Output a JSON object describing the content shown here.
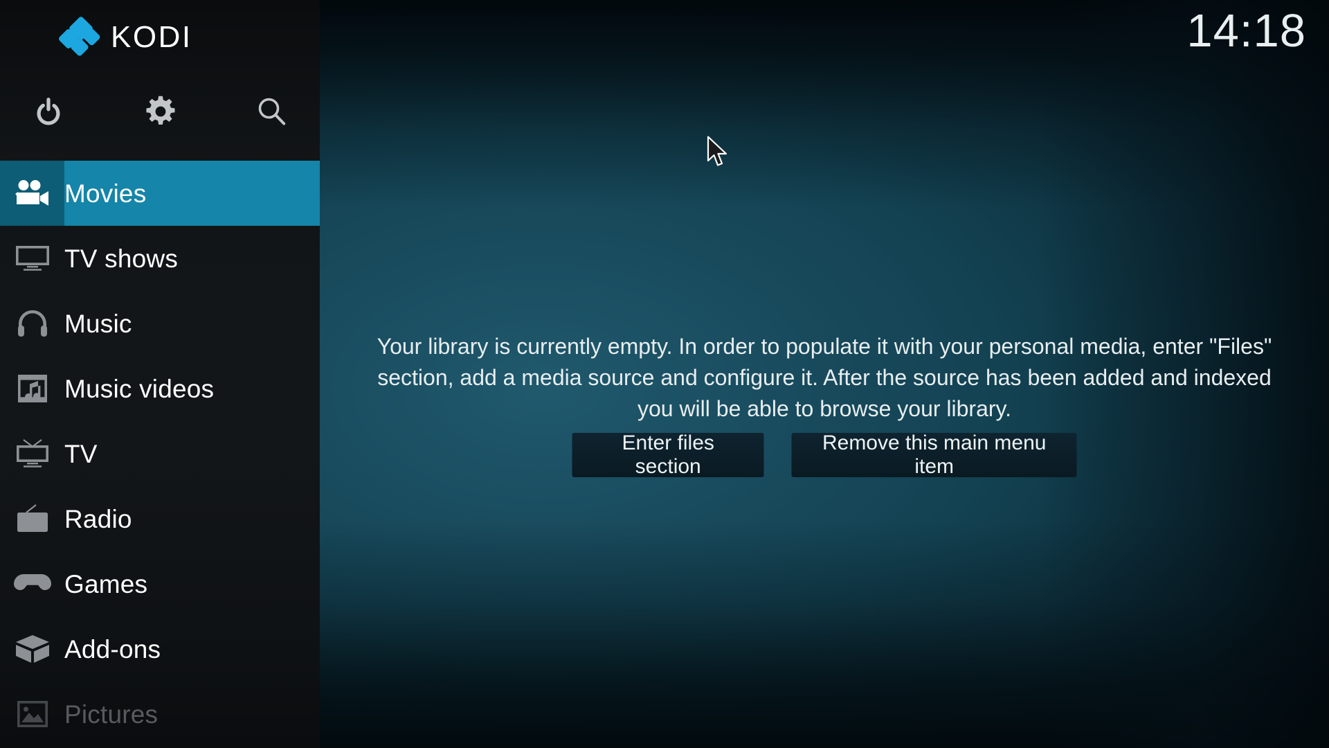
{
  "app": {
    "name": "KODI",
    "trademark": "™",
    "logo_color": "#1ca7e0"
  },
  "clock": {
    "time": "14:18"
  },
  "toolbar": {
    "buttons": [
      {
        "name": "power",
        "icon": "power-icon",
        "label": "Power"
      },
      {
        "name": "settings",
        "icon": "gear-icon",
        "label": "Settings"
      },
      {
        "name": "search",
        "icon": "search-icon",
        "label": "Search"
      }
    ]
  },
  "sidebar": {
    "selected_index": 0,
    "accent_color": "#1585a9",
    "accent_icon_color": "#0d5d76",
    "items": [
      {
        "label": "Movies",
        "icon": "movie-camera-icon",
        "selected": true,
        "dim": false
      },
      {
        "label": "TV shows",
        "icon": "monitor-icon",
        "selected": false,
        "dim": false
      },
      {
        "label": "Music",
        "icon": "headphones-icon",
        "selected": false,
        "dim": false
      },
      {
        "label": "Music videos",
        "icon": "film-music-icon",
        "selected": false,
        "dim": false
      },
      {
        "label": "TV",
        "icon": "television-icon",
        "selected": false,
        "dim": false
      },
      {
        "label": "Radio",
        "icon": "radio-icon",
        "selected": false,
        "dim": false
      },
      {
        "label": "Games",
        "icon": "gamepad-icon",
        "selected": false,
        "dim": false
      },
      {
        "label": "Add-ons",
        "icon": "addon-box-icon",
        "selected": false,
        "dim": false
      },
      {
        "label": "Pictures",
        "icon": "picture-icon",
        "selected": false,
        "dim": true
      }
    ]
  },
  "main": {
    "empty_message": "Your library is currently empty. In order to populate it with your personal media, enter \"Files\" section, add a media source and configure it. After the source has been added and indexed you will be able to browse your library.",
    "buttons": [
      {
        "label": "Enter files section"
      },
      {
        "label": "Remove this main menu item"
      }
    ]
  }
}
